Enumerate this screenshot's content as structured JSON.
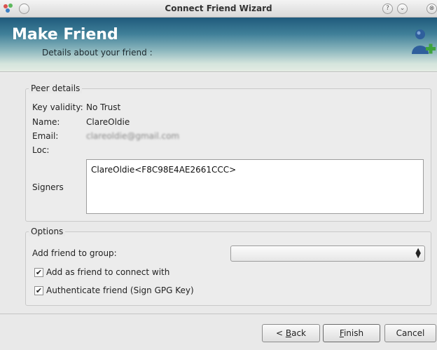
{
  "window": {
    "title": "Connect Friend Wizard",
    "help_glyph": "?",
    "minimize_glyph": "⌄",
    "close_glyph": "⊗"
  },
  "header": {
    "title": "Make Friend",
    "subtitle": "Details about your friend :",
    "icon": "add-friend-icon"
  },
  "peer_details": {
    "group_title": "Peer details",
    "key_validity_label": "Key validity:",
    "key_validity_value": "No Trust",
    "name_label": "Name:",
    "name_value": "ClareOldie",
    "email_label": "Email:",
    "email_value": "clareoldie@gmail.com",
    "loc_label": "Loc:",
    "signers_label": "Signers",
    "signers": [
      "ClareOldie<F8C98E4AE2661CCC>"
    ]
  },
  "options": {
    "group_title": "Options",
    "add_to_group_label": "Add friend to group:",
    "group_select_value": "",
    "add_as_friend_label": "Add as friend to connect with",
    "add_as_friend_checked": true,
    "authenticate_label": "Authenticate friend (Sign GPG Key)",
    "authenticate_checked": true
  },
  "buttons": {
    "back_prefix": "< ",
    "back_mnemonic": "B",
    "back_rest": "ack",
    "finish_mnemonic": "F",
    "finish_rest": "inish",
    "cancel": "Cancel"
  },
  "colors": {
    "header_dark": "#1f5a7c",
    "header_light": "#e4ece4"
  }
}
